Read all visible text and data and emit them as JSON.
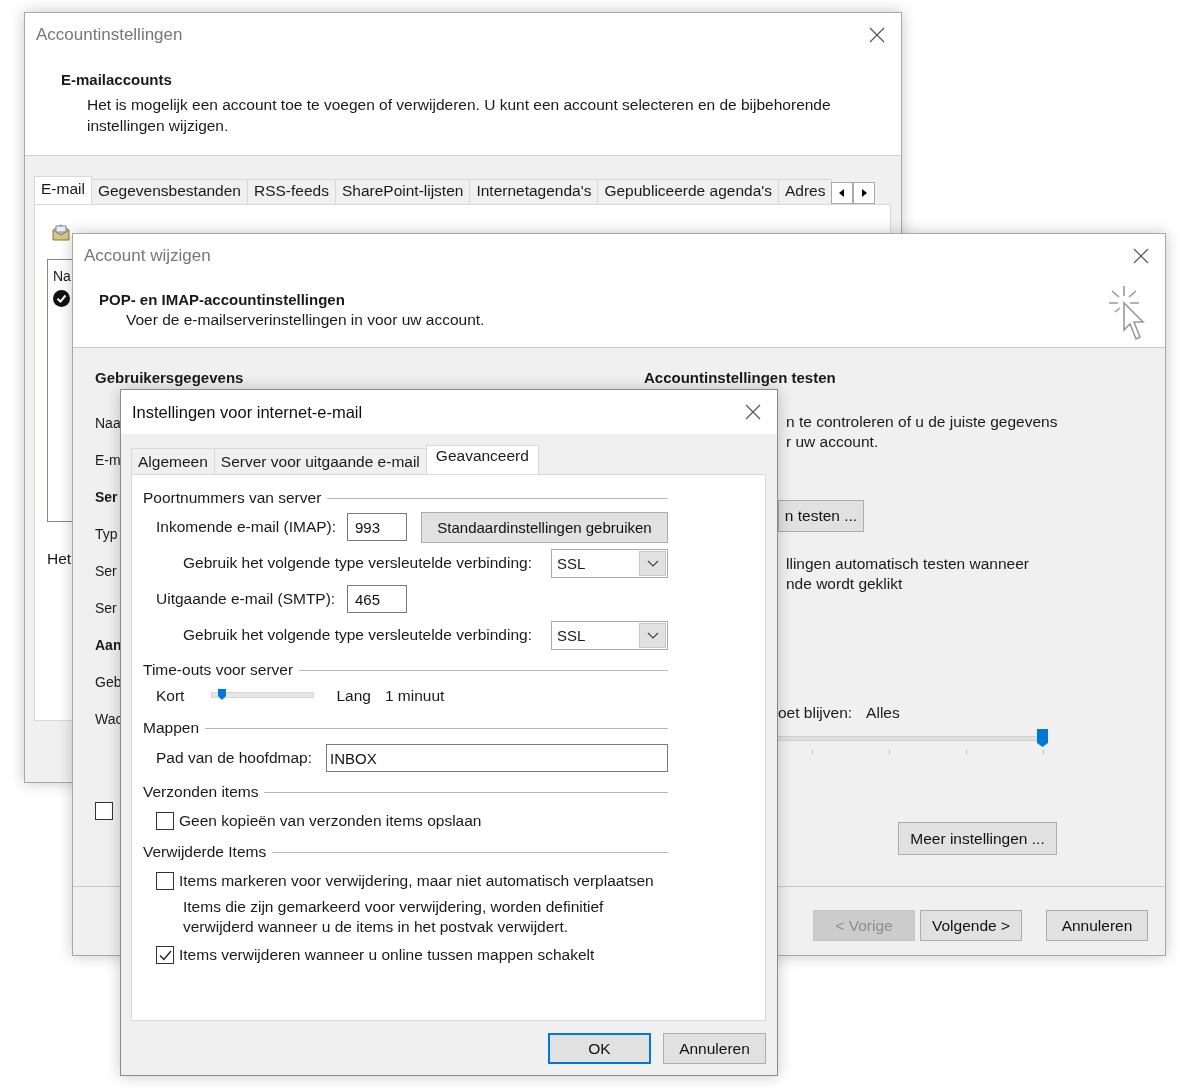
{
  "account_settings_window": {
    "title": "Accountinstellingen",
    "heading": "E-mailaccounts",
    "description": "Het is mogelijk een account toe te voegen of verwijderen. U kunt een account selecteren en de bijbehorende instellingen wijzigen.",
    "tabs": [
      {
        "label": "E-mail",
        "selected": true
      },
      {
        "label": "Gegevensbestanden",
        "selected": false
      },
      {
        "label": "RSS-feeds",
        "selected": false
      },
      {
        "label": "SharePoint-lijsten",
        "selected": false
      },
      {
        "label": "Internetagenda's",
        "selected": false
      },
      {
        "label": "Gepubliceerde agenda's",
        "selected": false
      },
      {
        "label": "Adres",
        "selected": false
      }
    ],
    "list_column": "Na",
    "footer_text": "Het"
  },
  "change_account_window": {
    "title": "Account wijzigen",
    "heading": "POP- en IMAP-accountinstellingen",
    "subtitle": "Voer de e-mailserverinstellingen in voor uw account.",
    "left_items": [
      {
        "kind": "heading",
        "text": "Gebruikersgegevens"
      },
      {
        "kind": "label",
        "text": "Naa"
      },
      {
        "kind": "label",
        "text": "E-m"
      },
      {
        "kind": "heading",
        "text": "Ser"
      },
      {
        "kind": "label",
        "text": "Typ"
      },
      {
        "kind": "label",
        "text": "Ser"
      },
      {
        "kind": "label",
        "text": "Ser"
      },
      {
        "kind": "heading",
        "text": "Aan"
      },
      {
        "kind": "label",
        "text": "Geb"
      },
      {
        "kind": "label",
        "text": "Wac"
      }
    ],
    "left_checkbox": {
      "checked": false
    },
    "test_heading": "Accountinstellingen testen",
    "test_text": "n te controleren of u de juiste gegevens\nr uw account.",
    "test_button": "n testen ...",
    "auto_test_text": "llingen automatisch testen wanneer\nnde wordt geklikt",
    "keep_label": "oet blijven:",
    "keep_value": "Alles",
    "keep_slider": {
      "level": 1
    },
    "more_button": "Meer instellingen ...",
    "buttons": [
      {
        "label": "< Vorige",
        "disabled": true
      },
      {
        "label": "Volgende >",
        "disabled": false
      },
      {
        "label": "Annuleren",
        "disabled": false
      }
    ]
  },
  "internet_email_window": {
    "title": "Instellingen voor internet-e-mail",
    "tabs": [
      {
        "label": "Algemeen",
        "selected": false
      },
      {
        "label": "Server voor uitgaande e-mail",
        "selected": false
      },
      {
        "label": "Geavanceerd",
        "selected": true
      }
    ],
    "sections": [
      {
        "title": "Poortnummers van server",
        "rows": [
          {
            "kind": "port",
            "label": "Inkomende e-mail (IMAP):",
            "value": "993",
            "button": "Standaardinstellingen gebruiken"
          },
          {
            "kind": "select",
            "label": "Gebruik het volgende type versleutelde verbinding:",
            "value": "SSL"
          },
          {
            "kind": "port",
            "label": "Uitgaande e-mail (SMTP):",
            "value": "465"
          },
          {
            "kind": "select",
            "label": "Gebruik het volgende type versleutelde verbinding:",
            "value": "SSL"
          }
        ]
      },
      {
        "title": "Time-outs voor server",
        "rows": [
          {
            "kind": "slider",
            "min_label": "Kort",
            "max_label": "Lang",
            "reading": "1 minuut",
            "level": 0.1
          }
        ]
      },
      {
        "title": "Mappen",
        "rows": [
          {
            "kind": "text_input",
            "label": "Pad van de hoofdmap:",
            "value": "INBOX"
          }
        ]
      },
      {
        "title": "Verzonden items",
        "rows": [
          {
            "kind": "checkbox",
            "label": "Geen kopieën van verzonden items opslaan",
            "checked": false
          }
        ]
      },
      {
        "title": "Verwijderde Items",
        "rows": [
          {
            "kind": "checkbox",
            "label": "Items markeren voor verwijdering, maar niet automatisch verplaatsen",
            "checked": false
          },
          {
            "kind": "note",
            "text": "Items die zijn gemarkeerd voor verwijdering, worden definitief verwijderd wanneer u de items in het postvak verwijdert."
          },
          {
            "kind": "checkbox",
            "label": "Items verwijderen wanneer u online tussen mappen schakelt",
            "checked": true
          }
        ]
      }
    ],
    "buttons": [
      {
        "label": "OK",
        "default": true
      },
      {
        "label": "Annuleren",
        "default": false
      }
    ]
  }
}
